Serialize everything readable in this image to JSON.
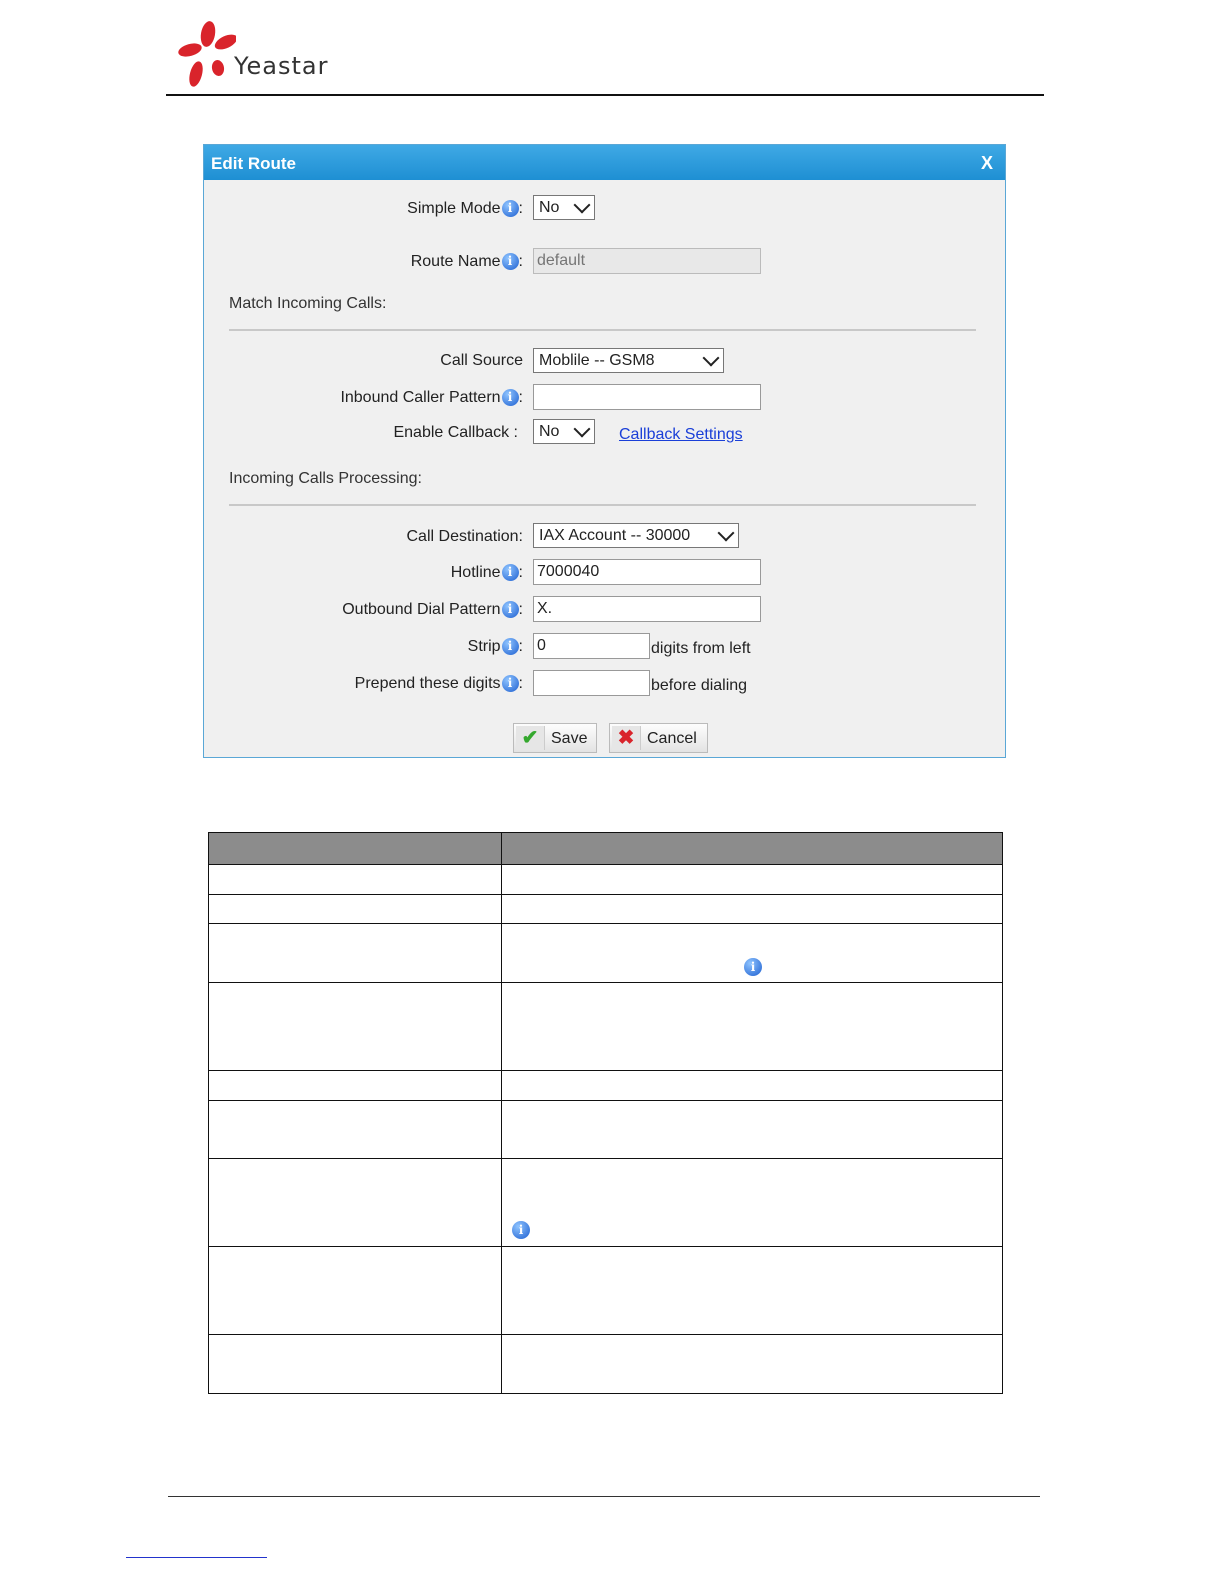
{
  "brand": {
    "name": "Yeastar",
    "petal_color": "#d9242b"
  },
  "dialog": {
    "title": "Edit Route",
    "close_label": "X",
    "fields": {
      "simple_mode": {
        "label": "Simple Mode",
        "value": "No"
      },
      "route_name": {
        "label": "Route Name",
        "placeholder": "default"
      },
      "section_match": "Match Incoming Calls:",
      "call_source": {
        "label": "Call Source",
        "value": "Moblile -- GSM8"
      },
      "inbound_caller_pattern": {
        "label": "Inbound Caller Pattern",
        "value": ""
      },
      "enable_callback": {
        "label": "Enable Callback :",
        "value": "No",
        "link": "Callback Settings"
      },
      "section_processing": "Incoming Calls Processing:",
      "call_destination": {
        "label": "Call Destination:",
        "value": "IAX Account -- 30000"
      },
      "hotline": {
        "label": "Hotline",
        "value": "7000040"
      },
      "outbound_dial_pattern": {
        "label": "Outbound Dial Pattern",
        "value": "X."
      },
      "strip": {
        "label": "Strip",
        "value": "0",
        "suffix": "digits from left"
      },
      "prepend": {
        "label": "Prepend these digits",
        "value": "",
        "suffix": "before dialing"
      }
    },
    "buttons": {
      "save": "Save",
      "cancel": "Cancel"
    }
  },
  "colon": ":",
  "icons": {
    "info": "i",
    "check": "✔",
    "cross": "✖"
  },
  "accent_colors": {
    "title_bar": "#2e9ddc",
    "link": "#1a3fd8",
    "table_header": "#8c8c8c"
  }
}
